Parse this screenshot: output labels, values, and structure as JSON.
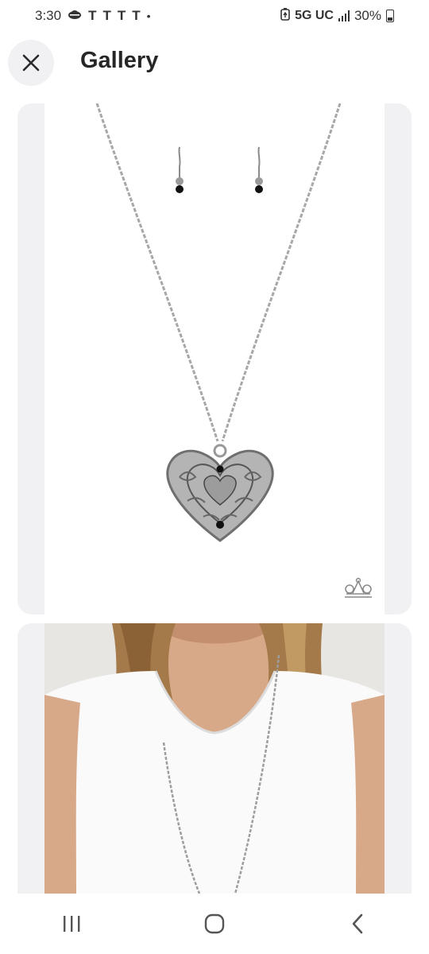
{
  "status_bar": {
    "time": "3:30",
    "carrier_icons": [
      "T",
      "T",
      "T",
      "T"
    ],
    "dot": "•",
    "network": "5G UC",
    "battery": "30%"
  },
  "header": {
    "title": "Gallery",
    "close_icon": "close-icon"
  },
  "gallery": {
    "images": [
      {
        "description_icon": "necklace-product-photo",
        "watermark_icon": "crown-logo-icon"
      },
      {
        "description_icon": "model-wearing-necklace-photo"
      }
    ]
  },
  "nav": {
    "icons": [
      "recent-apps-icon",
      "home-icon",
      "back-icon"
    ]
  }
}
